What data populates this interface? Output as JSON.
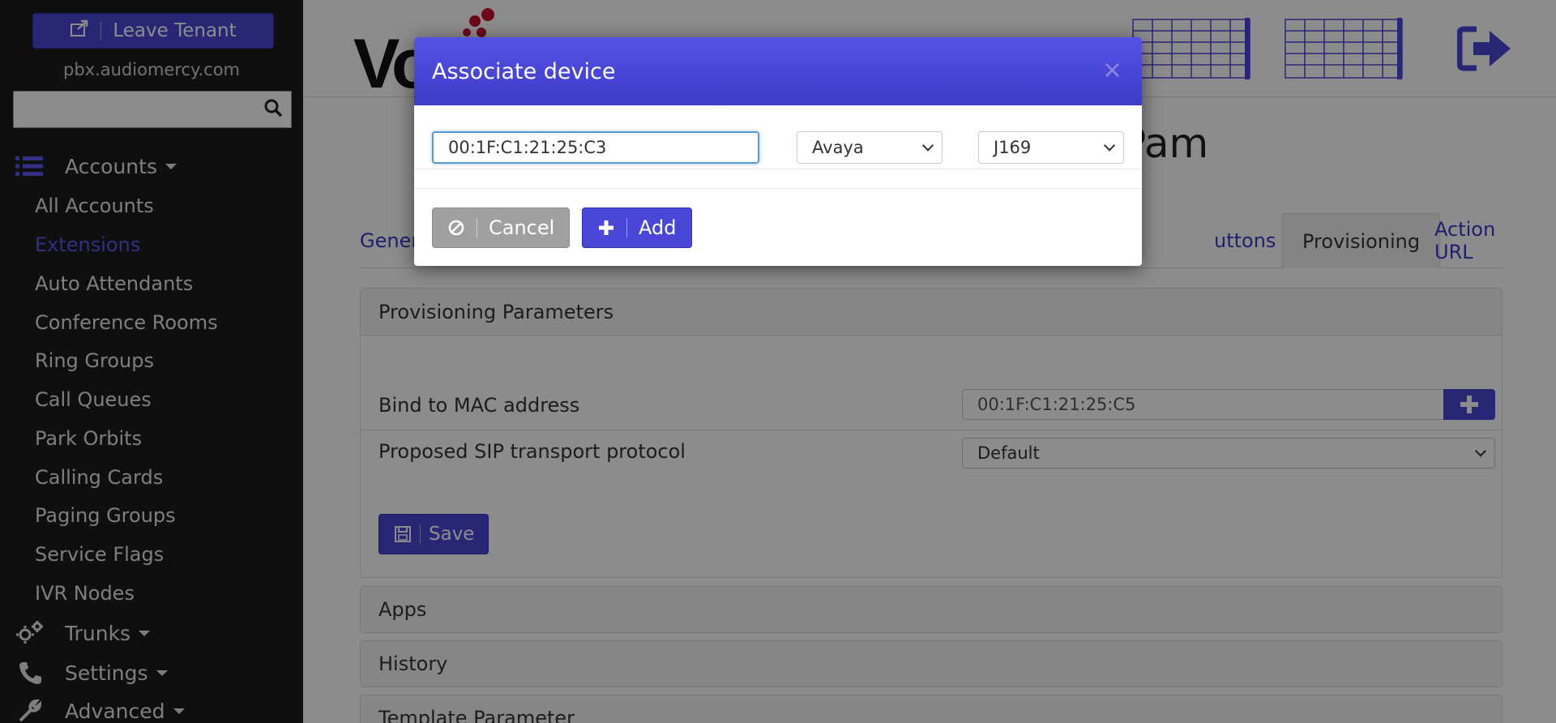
{
  "sidebar": {
    "leave_tenant_label": "Leave Tenant",
    "domain": "pbx.audiomercy.com",
    "search_placeholder": "",
    "accounts_label": "Accounts",
    "items": [
      {
        "label": "All Accounts"
      },
      {
        "label": "Extensions"
      },
      {
        "label": "Auto Attendants"
      },
      {
        "label": "Conference Rooms"
      },
      {
        "label": "Ring Groups"
      },
      {
        "label": "Call Queues"
      },
      {
        "label": "Park Orbits"
      },
      {
        "label": "Calling Cards"
      },
      {
        "label": "Paging Groups"
      },
      {
        "label": "Service Flags"
      },
      {
        "label": "IVR Nodes"
      }
    ],
    "active_item": "Extensions",
    "trunks_label": "Trunks",
    "settings_label": "Settings",
    "advanced_label": "Advanced"
  },
  "header": {
    "logo_text": "Vo"
  },
  "page": {
    "title_fragment": "Pam"
  },
  "tabs": [
    {
      "label": "Gener"
    },
    {
      "label": "uttons"
    },
    {
      "label": "Provisioning"
    },
    {
      "label": "Action URL"
    }
  ],
  "active_tab": "Provisioning",
  "provisioning": {
    "heading": "Provisioning Parameters",
    "bind_mac_label": "Bind to MAC address",
    "bind_mac_value": "00:1F:C1:21:25:C5",
    "sip_label": "Proposed SIP transport protocol",
    "sip_value": "Default",
    "save_label": "Save"
  },
  "sections": [
    {
      "label": "Apps"
    },
    {
      "label": "History"
    },
    {
      "label": "Template Parameter"
    }
  ],
  "modal": {
    "title": "Associate device",
    "close_glyph": "×",
    "mac_value": "00:1F:C1:21:25:C3",
    "vendor_value": "Avaya",
    "model_value": "J169",
    "cancel_label": "Cancel",
    "add_label": "Add"
  },
  "colors": {
    "accent": "#4a47d8",
    "sidebar_bg": "#1c1c1c",
    "logo_red": "#c8102e"
  }
}
